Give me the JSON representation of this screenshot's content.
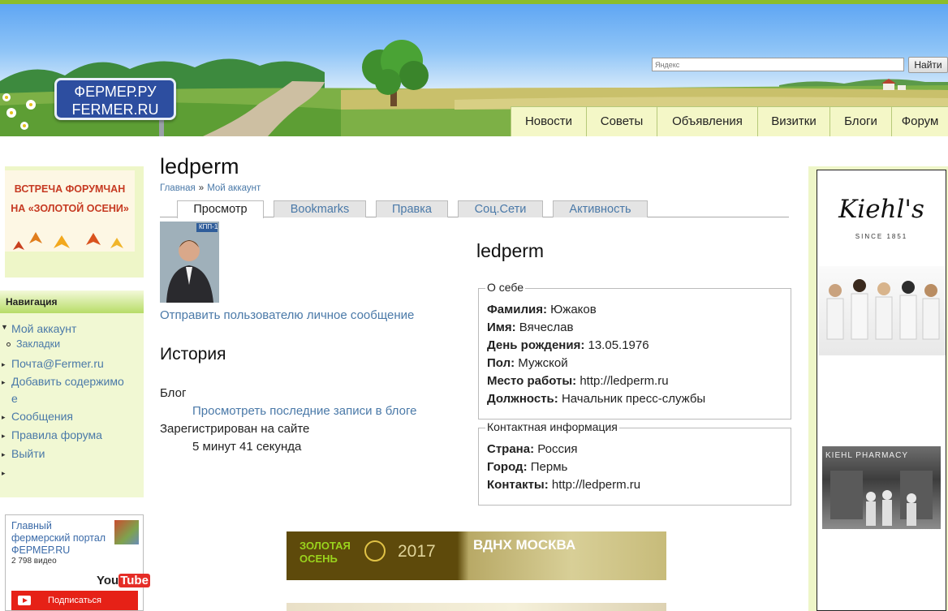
{
  "header": {
    "logo_line1": "ФЕРМЕР.РУ",
    "logo_line2": "FERMER.RU",
    "search_placeholder": "Яндекс",
    "search_button": "Найти",
    "nav": [
      "Новости",
      "Советы",
      "Объявления",
      "Визитки",
      "Блоги",
      "Форум"
    ]
  },
  "sidebar": {
    "promo_line1": "ВСТРЕЧА ФОРУМЧАН",
    "promo_line2": "НА «ЗОЛОТОЙ ОСЕНИ»",
    "nav_title": "Навигация",
    "items": {
      "my_account": "Мой аккаунт",
      "bookmarks": "Закладки",
      "mail": "Почта@Fermer.ru",
      "add_content_1": "Добавить содержимо",
      "add_content_2": "е",
      "messages": "Сообщения",
      "forum_rules": "Правила форума",
      "logout": "Выйти"
    },
    "youtube": {
      "title": "Главный фермерский портал ФЕРМЕР.RU",
      "count": "2 798 видео",
      "logo_you": "You",
      "logo_tube": "Tube",
      "subscribe": "Подписаться"
    }
  },
  "main": {
    "title": "ledperm",
    "breadcrumb": [
      "Главная",
      "Мой аккаунт"
    ],
    "breadcrumb_sep": "»",
    "tabs": [
      "Просмотр",
      "Bookmarks",
      "Правка",
      "Соц.Сети",
      "Активность"
    ],
    "avatar_badge": "КПП-1",
    "send_message": "Отправить пользователю личное сообщение",
    "history_title": "История",
    "history_blog_label": "Блог",
    "history_blog_link": "Просмотреть последние записи в блоге",
    "history_reg_label": "Зарегистрирован на сайте",
    "history_reg_value": "5 минут 41 секунда",
    "profile_name": "ledperm",
    "about": {
      "legend": "О себе",
      "rows": [
        {
          "label": "Фамилия:",
          "value": "Южаков"
        },
        {
          "label": "Имя:",
          "value": "Вячеслав"
        },
        {
          "label": "День рождения:",
          "value": "13.05.1976"
        },
        {
          "label": "Пол:",
          "value": "Мужской"
        },
        {
          "label": "Место работы:",
          "value": "http://ledperm.ru"
        },
        {
          "label": "Должность:",
          "value": "Начальник пресс-службы"
        }
      ]
    },
    "contacts": {
      "legend": "Контактная информация",
      "rows": [
        {
          "label": "Страна:",
          "value": "Россия"
        },
        {
          "label": "Город:",
          "value": "Пермь"
        },
        {
          "label": "Контакты:",
          "value": "http://ledperm.ru"
        }
      ]
    },
    "banner": {
      "line1": "ЗОЛОТАЯ",
      "line2": "ОСЕНЬ",
      "year": "2017",
      "city": "ВДНХ МОСКВА"
    }
  },
  "right_ad": {
    "brand": "Kiehl's",
    "since": "SINCE 1851",
    "sign": "KIEHL PHARMACY"
  }
}
